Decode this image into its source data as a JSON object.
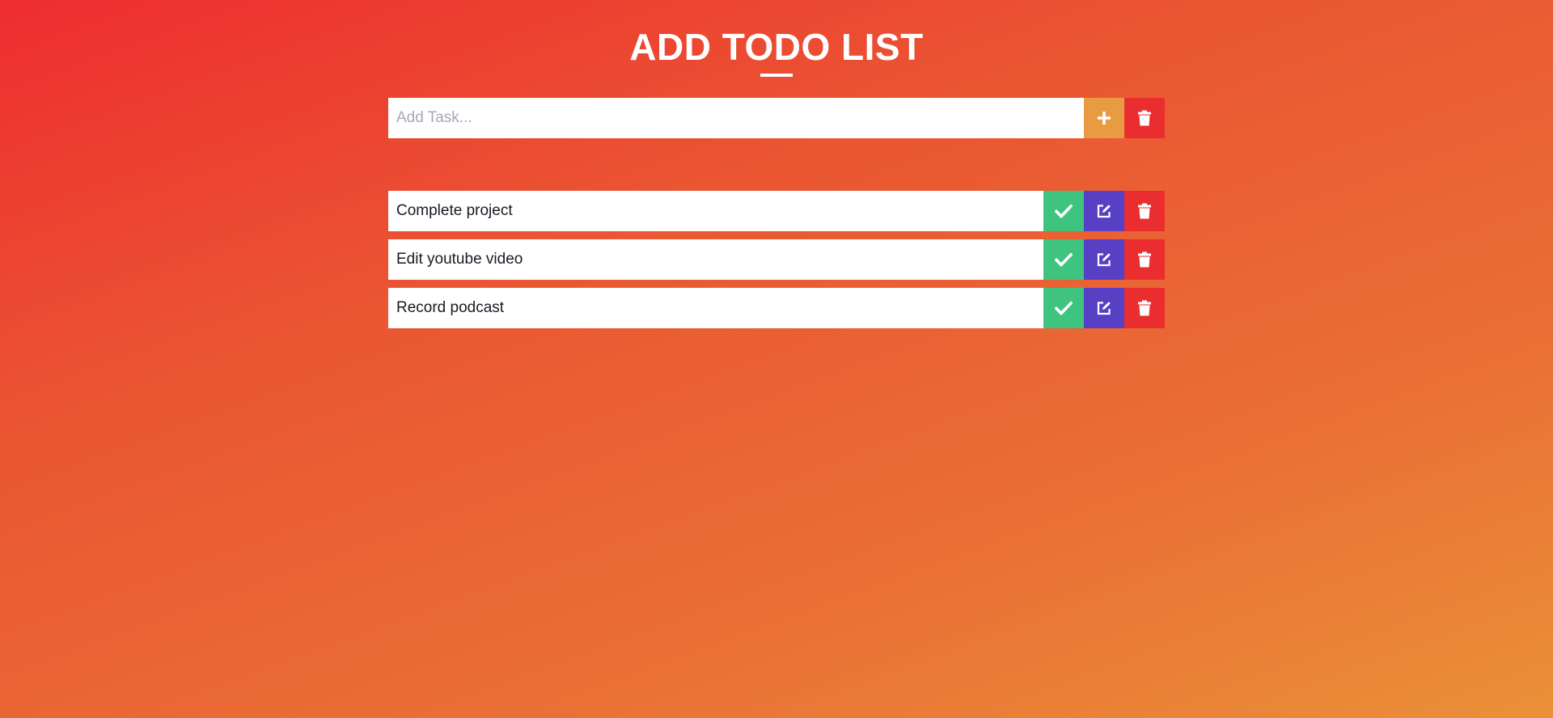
{
  "header": {
    "title": "ADD TODO LIST"
  },
  "add_form": {
    "input_value": "",
    "placeholder": "Add Task...",
    "add_icon": "plus-icon",
    "clear_icon": "trash-icon"
  },
  "todos": [
    {
      "text": "Complete project"
    },
    {
      "text": "Edit youtube video"
    },
    {
      "text": "Record podcast"
    }
  ],
  "item_icons": {
    "done": "check-icon",
    "edit": "edit-icon",
    "delete": "trash-icon"
  },
  "colors": {
    "add_button": "#e89b43",
    "clear_button": "#ea2e2f",
    "done_button": "#3ec47e",
    "edit_button": "#5740c4",
    "delete_button": "#ea2e2f",
    "gradient_start": "#ee2d30",
    "gradient_end": "#ea9038"
  }
}
